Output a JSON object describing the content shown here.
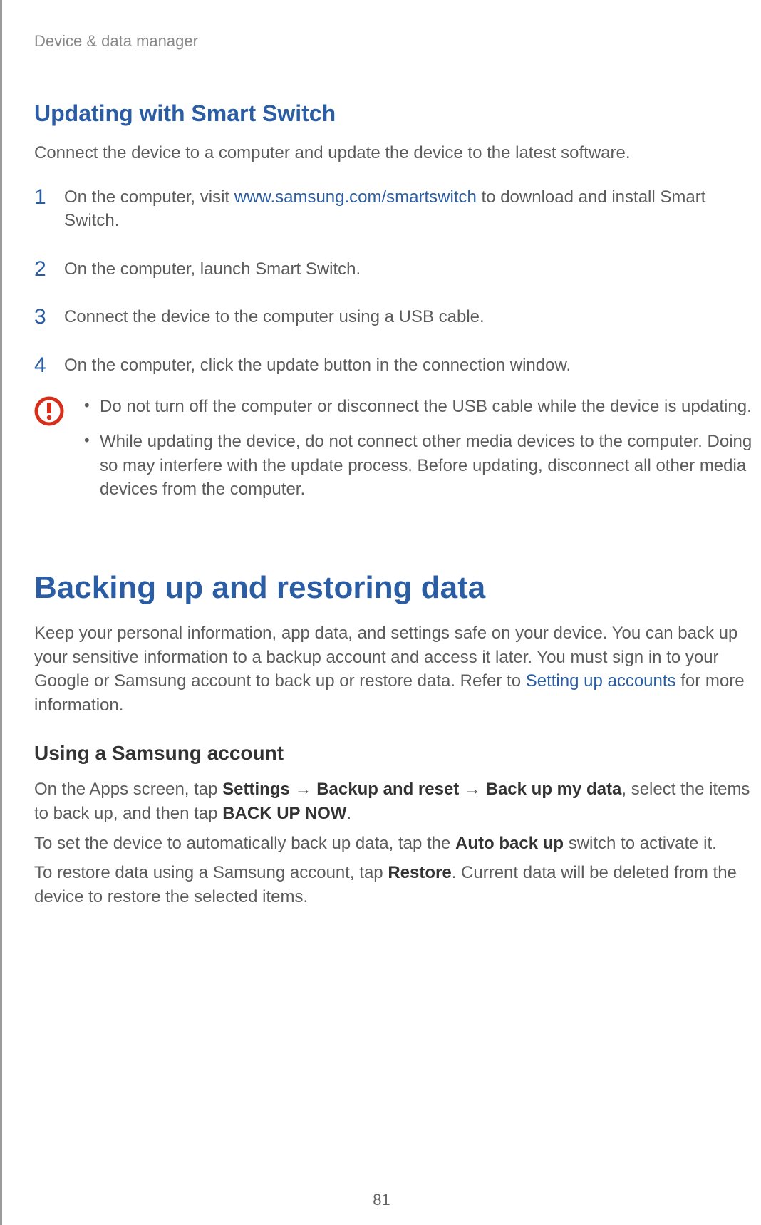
{
  "breadcrumb": "Device & data manager",
  "section1": {
    "heading": "Updating with Smart Switch",
    "intro": "Connect the device to a computer and update the device to the latest software.",
    "step1_a": "On the computer, visit ",
    "step1_link": "www.samsung.com/smartswitch",
    "step1_b": " to download and install Smart Switch.",
    "step2": "On the computer, launch Smart Switch.",
    "step3": "Connect the device to the computer using a USB cable.",
    "step4": "On the computer, click the update button in the connection window.",
    "caution1": "Do not turn off the computer or disconnect the USB cable while the device is updating.",
    "caution2": "While updating the device, do not connect other media devices to the computer. Doing so may interfere with the update process. Before updating, disconnect all other media devices from the computer."
  },
  "section2": {
    "heading": "Backing up and restoring data",
    "intro_a": "Keep your personal information, app data, and settings safe on your device. You can back up your sensitive information to a backup account and access it later. You must sign in to your Google or Samsung account to back up or restore data. Refer to ",
    "intro_link": "Setting up accounts",
    "intro_b": " for more information.",
    "subheading": "Using a Samsung account",
    "p1_a": "On the Apps screen, tap ",
    "p1_b1": "Settings",
    "p1_arrow1": " → ",
    "p1_b2": "Backup and reset",
    "p1_arrow2": " → ",
    "p1_b3": "Back up my data",
    "p1_c": ", select the items to back up, and then tap ",
    "p1_b4": "BACK UP NOW",
    "p1_d": ".",
    "p2_a": "To set the device to automatically back up data, tap the ",
    "p2_b": "Auto back up",
    "p2_c": " switch to activate it.",
    "p3_a": "To restore data using a Samsung account, tap ",
    "p3_b": "Restore",
    "p3_c": ". Current data will be deleted from the device to restore the selected items."
  },
  "page_number": "81"
}
